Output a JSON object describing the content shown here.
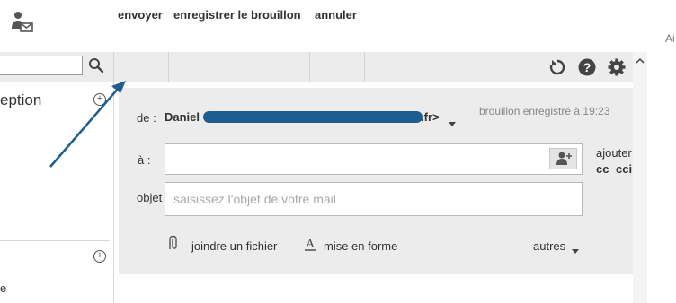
{
  "toolbar": {
    "send_label": "envoyer",
    "save_draft_label": "enregistrer le brouillon",
    "cancel_label": "annuler"
  },
  "sidebar": {
    "folder_partial": "eption",
    "item_partial": "e"
  },
  "compose": {
    "from_label": "de :",
    "from_name": "Daniel",
    "from_suffix": ".fr>",
    "draft_status": "brouillon enregistré à 19:23",
    "to_label": "à :",
    "add_label": "ajouter",
    "cc_label": "cc",
    "bcc_label": "cci",
    "subject_label": "objet",
    "subject_placeholder": "saisissez l'objet de votre mail",
    "attach_label": "joindre un fichier",
    "format_label": "mise en forme",
    "more_label": "autres"
  },
  "edge_text": "Ai",
  "colors": {
    "toolbar_bg": "#ececec",
    "redaction": "#1f5d8f",
    "annotation_arrow": "#1f5d8f"
  }
}
